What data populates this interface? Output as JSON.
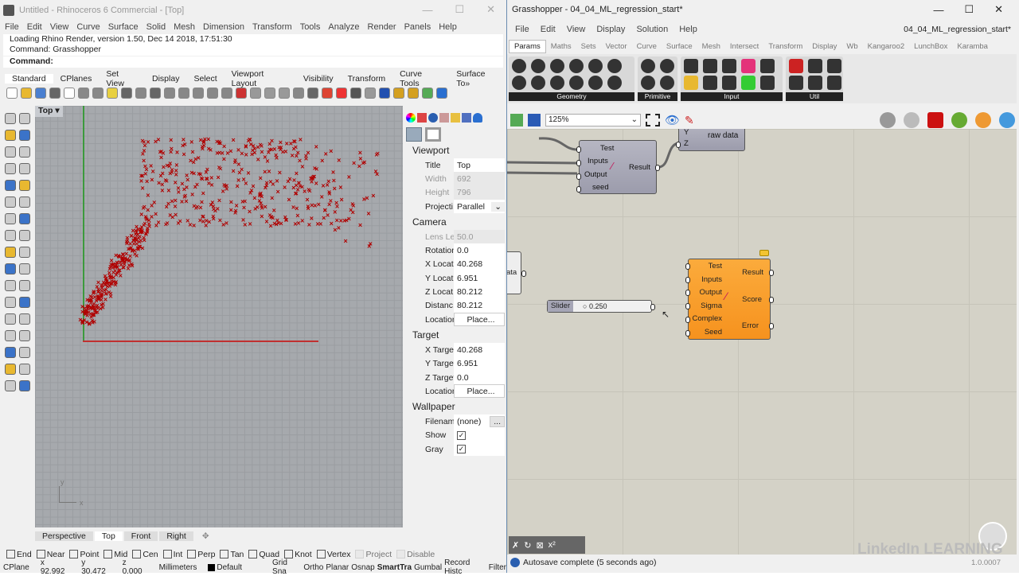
{
  "rhino": {
    "title": "Untitled - Rhinoceros 6 Commercial - [Top]",
    "menu": [
      "File",
      "Edit",
      "View",
      "Curve",
      "Surface",
      "Solid",
      "Mesh",
      "Dimension",
      "Transform",
      "Tools",
      "Analyze",
      "Render",
      "Panels",
      "Help"
    ],
    "history": [
      "Loading Rhino Render, version 1.50, Dec 14 2018, 17:51:30",
      "Command: Grasshopper"
    ],
    "command_label": "Command:",
    "toolbar_tabs": [
      "Standard",
      "CPlanes",
      "Set View",
      "Display",
      "Select",
      "Viewport Layout",
      "Visibility",
      "Transform",
      "Curve Tools",
      "Surface To»"
    ],
    "viewport_title": "Top",
    "axis_labels": {
      "y": "y",
      "x": "x"
    },
    "viewport_tabs": [
      "Perspective",
      "Top",
      "Front",
      "Right"
    ],
    "active_viewport_tab": "Top",
    "scatter_color": "#b00000",
    "osnaps": [
      {
        "label": "End",
        "checked": false
      },
      {
        "label": "Near",
        "checked": false
      },
      {
        "label": "Point",
        "checked": false
      },
      {
        "label": "Mid",
        "checked": false
      },
      {
        "label": "Cen",
        "checked": false
      },
      {
        "label": "Int",
        "checked": false
      },
      {
        "label": "Perp",
        "checked": false
      },
      {
        "label": "Tan",
        "checked": false
      },
      {
        "label": "Quad",
        "checked": false
      },
      {
        "label": "Knot",
        "checked": false
      },
      {
        "label": "Vertex",
        "checked": false
      },
      {
        "label": "Project",
        "checked": false,
        "disabled": true
      },
      {
        "label": "Disable",
        "checked": false,
        "disabled": true
      }
    ],
    "status": {
      "cplane": "CPlane",
      "x": "x 92.992",
      "y": "y 30.472",
      "z": "z 0.000",
      "units": "Millimeters",
      "layer": "Default",
      "toggles": [
        "Grid Sna",
        "Ortho",
        "Planar",
        "Osnap",
        "SmartTra",
        "Gumbal",
        "Record Histc",
        "Filter"
      ],
      "active_toggle": "SmartTra"
    },
    "properties": {
      "viewport": {
        "heading": "Viewport",
        "rows": [
          {
            "k": "Title",
            "v": "Top"
          },
          {
            "k": "Width",
            "v": "692",
            "disabled": true
          },
          {
            "k": "Height",
            "v": "796",
            "disabled": true
          },
          {
            "k": "Projecti...",
            "v": "Parallel",
            "dropdown": true
          }
        ]
      },
      "camera": {
        "heading": "Camera",
        "rows": [
          {
            "k": "Lens Le...",
            "v": "50.0",
            "disabled": true
          },
          {
            "k": "Rotation",
            "v": "0.0"
          },
          {
            "k": "X Locat...",
            "v": "40.268"
          },
          {
            "k": "Y Locat...",
            "v": "6.951"
          },
          {
            "k": "Z Locat...",
            "v": "80.212"
          },
          {
            "k": "Distanc...",
            "v": "80.212"
          },
          {
            "k": "Location",
            "v": "Place...",
            "button": true
          }
        ]
      },
      "target": {
        "heading": "Target",
        "rows": [
          {
            "k": "X Target",
            "v": "40.268"
          },
          {
            "k": "Y Target",
            "v": "6.951"
          },
          {
            "k": "Z Target",
            "v": "0.0"
          },
          {
            "k": "Location",
            "v": "Place...",
            "button": true
          }
        ]
      },
      "wallpaper": {
        "heading": "Wallpaper",
        "filename_label": "Filename",
        "filename": "(none)",
        "browse": "...",
        "show_label": "Show",
        "show": true,
        "gray_label": "Gray",
        "gray": true
      }
    }
  },
  "gh": {
    "title": "Grasshopper - 04_04_ML_regression_start*",
    "menu": [
      "File",
      "Edit",
      "View",
      "Display",
      "Solution",
      "Help"
    ],
    "doc_name": "04_04_ML_regression_start*",
    "tabs": [
      "Params",
      "Maths",
      "Sets",
      "Vector",
      "Curve",
      "Surface",
      "Mesh",
      "Intersect",
      "Transform",
      "Display",
      "Wb",
      "Kangaroo2",
      "LunchBox",
      "Karamba"
    ],
    "active_tab": "Params",
    "groups": [
      "Geometry",
      "Primitive",
      "Input",
      "Util"
    ],
    "zoom": "125%",
    "node1": {
      "inputs": [
        "Test",
        "Inputs",
        "Output",
        "seed"
      ],
      "output": "Result"
    },
    "node_top": {
      "inputs": [
        "Y",
        "Z"
      ],
      "label": "raw data"
    },
    "node_left": {
      "label": "ata"
    },
    "slider": {
      "label": "Slider",
      "value": "0.250"
    },
    "node2": {
      "inputs": [
        "Test",
        "Inputs",
        "Output",
        "Sigma",
        "Complex",
        "Seed"
      ],
      "outputs": [
        "Result",
        "Score",
        "Error"
      ],
      "color": "#f7961f"
    },
    "status": "Autosave complete (5 seconds ago)",
    "version": "1.0.0007",
    "brand": "LinkedIn LEARNING"
  }
}
